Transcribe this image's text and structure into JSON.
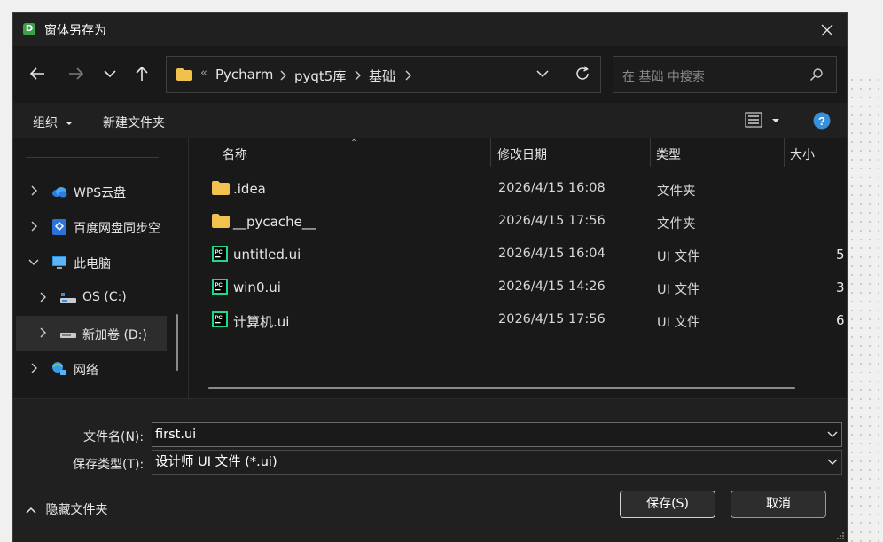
{
  "window": {
    "title": "窗体另存为",
    "app_icon_letter": "D"
  },
  "nav": {
    "back": "back-arrow-icon",
    "forward": "forward-arrow-icon",
    "recent": "chevron-down-icon",
    "up": "up-arrow-icon"
  },
  "address": {
    "overflow": "«",
    "segments": [
      "Pycharm",
      "pyqt5库",
      "基础"
    ]
  },
  "search": {
    "placeholder": "在 基础 中搜索"
  },
  "toolbar": {
    "organize": "组织",
    "new_folder": "新建文件夹"
  },
  "sidebar": {
    "items": [
      {
        "label": "WPS云盘",
        "icon": "cloud-icon"
      },
      {
        "label": "百度网盘同步空",
        "icon": "baidu-netdisk-icon"
      },
      {
        "label": "此电脑",
        "icon": "computer-icon"
      },
      {
        "label": "OS (C:)",
        "icon": "drive-icon"
      },
      {
        "label": "新加卷 (D:)",
        "icon": "drive-icon"
      },
      {
        "label": "网络",
        "icon": "network-icon"
      }
    ]
  },
  "columns": {
    "name": "名称",
    "date": "修改日期",
    "type": "类型",
    "size": "大小"
  },
  "files": [
    {
      "name": ".idea",
      "date": "2026/4/15 16:08",
      "type": "文件夹",
      "size": "",
      "icon": "folder-icon"
    },
    {
      "name": "__pycache__",
      "date": "2026/4/15 17:56",
      "type": "文件夹",
      "size": "",
      "icon": "folder-icon"
    },
    {
      "name": "untitled.ui",
      "date": "2026/4/15 16:04",
      "type": "UI 文件",
      "size": "5",
      "icon": "pycharm-file-icon"
    },
    {
      "name": "win0.ui",
      "date": "2026/4/15 14:26",
      "type": "UI 文件",
      "size": "3",
      "icon": "pycharm-file-icon"
    },
    {
      "name": "计算机.ui",
      "date": "2026/4/15 17:56",
      "type": "UI 文件",
      "size": "6",
      "icon": "pycharm-file-icon"
    }
  ],
  "form": {
    "filename_label": "文件名(N):",
    "filename_value": "first.ui",
    "filetype_label": "保存类型(T):",
    "filetype_value": "设计师 UI 文件 (*.ui)"
  },
  "buttons": {
    "save": "保存(S)",
    "cancel": "取消",
    "hide_folders": "隐藏文件夹"
  },
  "colors": {
    "background": "#202020",
    "pane": "#191919",
    "folder": "#f2c14e",
    "accent": "#3a8fd9"
  }
}
